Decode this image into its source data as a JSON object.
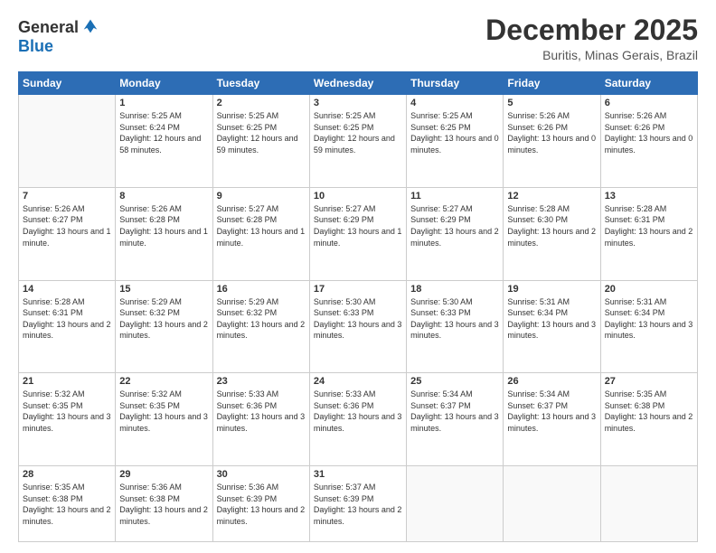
{
  "header": {
    "logo": {
      "line1": "General",
      "line2": "Blue"
    },
    "title": "December 2025",
    "location": "Buritis, Minas Gerais, Brazil"
  },
  "calendar": {
    "days_of_week": [
      "Sunday",
      "Monday",
      "Tuesday",
      "Wednesday",
      "Thursday",
      "Friday",
      "Saturday"
    ],
    "weeks": [
      [
        {
          "day": "",
          "sunrise": "",
          "sunset": "",
          "daylight": ""
        },
        {
          "day": "1",
          "sunrise": "Sunrise: 5:25 AM",
          "sunset": "Sunset: 6:24 PM",
          "daylight": "Daylight: 12 hours and 58 minutes."
        },
        {
          "day": "2",
          "sunrise": "Sunrise: 5:25 AM",
          "sunset": "Sunset: 6:25 PM",
          "daylight": "Daylight: 12 hours and 59 minutes."
        },
        {
          "day": "3",
          "sunrise": "Sunrise: 5:25 AM",
          "sunset": "Sunset: 6:25 PM",
          "daylight": "Daylight: 12 hours and 59 minutes."
        },
        {
          "day": "4",
          "sunrise": "Sunrise: 5:25 AM",
          "sunset": "Sunset: 6:25 PM",
          "daylight": "Daylight: 13 hours and 0 minutes."
        },
        {
          "day": "5",
          "sunrise": "Sunrise: 5:26 AM",
          "sunset": "Sunset: 6:26 PM",
          "daylight": "Daylight: 13 hours and 0 minutes."
        },
        {
          "day": "6",
          "sunrise": "Sunrise: 5:26 AM",
          "sunset": "Sunset: 6:26 PM",
          "daylight": "Daylight: 13 hours and 0 minutes."
        }
      ],
      [
        {
          "day": "7",
          "sunrise": "Sunrise: 5:26 AM",
          "sunset": "Sunset: 6:27 PM",
          "daylight": "Daylight: 13 hours and 1 minute."
        },
        {
          "day": "8",
          "sunrise": "Sunrise: 5:26 AM",
          "sunset": "Sunset: 6:28 PM",
          "daylight": "Daylight: 13 hours and 1 minute."
        },
        {
          "day": "9",
          "sunrise": "Sunrise: 5:27 AM",
          "sunset": "Sunset: 6:28 PM",
          "daylight": "Daylight: 13 hours and 1 minute."
        },
        {
          "day": "10",
          "sunrise": "Sunrise: 5:27 AM",
          "sunset": "Sunset: 6:29 PM",
          "daylight": "Daylight: 13 hours and 1 minute."
        },
        {
          "day": "11",
          "sunrise": "Sunrise: 5:27 AM",
          "sunset": "Sunset: 6:29 PM",
          "daylight": "Daylight: 13 hours and 2 minutes."
        },
        {
          "day": "12",
          "sunrise": "Sunrise: 5:28 AM",
          "sunset": "Sunset: 6:30 PM",
          "daylight": "Daylight: 13 hours and 2 minutes."
        },
        {
          "day": "13",
          "sunrise": "Sunrise: 5:28 AM",
          "sunset": "Sunset: 6:31 PM",
          "daylight": "Daylight: 13 hours and 2 minutes."
        }
      ],
      [
        {
          "day": "14",
          "sunrise": "Sunrise: 5:28 AM",
          "sunset": "Sunset: 6:31 PM",
          "daylight": "Daylight: 13 hours and 2 minutes."
        },
        {
          "day": "15",
          "sunrise": "Sunrise: 5:29 AM",
          "sunset": "Sunset: 6:32 PM",
          "daylight": "Daylight: 13 hours and 2 minutes."
        },
        {
          "day": "16",
          "sunrise": "Sunrise: 5:29 AM",
          "sunset": "Sunset: 6:32 PM",
          "daylight": "Daylight: 13 hours and 2 minutes."
        },
        {
          "day": "17",
          "sunrise": "Sunrise: 5:30 AM",
          "sunset": "Sunset: 6:33 PM",
          "daylight": "Daylight: 13 hours and 3 minutes."
        },
        {
          "day": "18",
          "sunrise": "Sunrise: 5:30 AM",
          "sunset": "Sunset: 6:33 PM",
          "daylight": "Daylight: 13 hours and 3 minutes."
        },
        {
          "day": "19",
          "sunrise": "Sunrise: 5:31 AM",
          "sunset": "Sunset: 6:34 PM",
          "daylight": "Daylight: 13 hours and 3 minutes."
        },
        {
          "day": "20",
          "sunrise": "Sunrise: 5:31 AM",
          "sunset": "Sunset: 6:34 PM",
          "daylight": "Daylight: 13 hours and 3 minutes."
        }
      ],
      [
        {
          "day": "21",
          "sunrise": "Sunrise: 5:32 AM",
          "sunset": "Sunset: 6:35 PM",
          "daylight": "Daylight: 13 hours and 3 minutes."
        },
        {
          "day": "22",
          "sunrise": "Sunrise: 5:32 AM",
          "sunset": "Sunset: 6:35 PM",
          "daylight": "Daylight: 13 hours and 3 minutes."
        },
        {
          "day": "23",
          "sunrise": "Sunrise: 5:33 AM",
          "sunset": "Sunset: 6:36 PM",
          "daylight": "Daylight: 13 hours and 3 minutes."
        },
        {
          "day": "24",
          "sunrise": "Sunrise: 5:33 AM",
          "sunset": "Sunset: 6:36 PM",
          "daylight": "Daylight: 13 hours and 3 minutes."
        },
        {
          "day": "25",
          "sunrise": "Sunrise: 5:34 AM",
          "sunset": "Sunset: 6:37 PM",
          "daylight": "Daylight: 13 hours and 3 minutes."
        },
        {
          "day": "26",
          "sunrise": "Sunrise: 5:34 AM",
          "sunset": "Sunset: 6:37 PM",
          "daylight": "Daylight: 13 hours and 3 minutes."
        },
        {
          "day": "27",
          "sunrise": "Sunrise: 5:35 AM",
          "sunset": "Sunset: 6:38 PM",
          "daylight": "Daylight: 13 hours and 2 minutes."
        }
      ],
      [
        {
          "day": "28",
          "sunrise": "Sunrise: 5:35 AM",
          "sunset": "Sunset: 6:38 PM",
          "daylight": "Daylight: 13 hours and 2 minutes."
        },
        {
          "day": "29",
          "sunrise": "Sunrise: 5:36 AM",
          "sunset": "Sunset: 6:38 PM",
          "daylight": "Daylight: 13 hours and 2 minutes."
        },
        {
          "day": "30",
          "sunrise": "Sunrise: 5:36 AM",
          "sunset": "Sunset: 6:39 PM",
          "daylight": "Daylight: 13 hours and 2 minutes."
        },
        {
          "day": "31",
          "sunrise": "Sunrise: 5:37 AM",
          "sunset": "Sunset: 6:39 PM",
          "daylight": "Daylight: 13 hours and 2 minutes."
        },
        {
          "day": "",
          "sunrise": "",
          "sunset": "",
          "daylight": ""
        },
        {
          "day": "",
          "sunrise": "",
          "sunset": "",
          "daylight": ""
        },
        {
          "day": "",
          "sunrise": "",
          "sunset": "",
          "daylight": ""
        }
      ]
    ]
  }
}
